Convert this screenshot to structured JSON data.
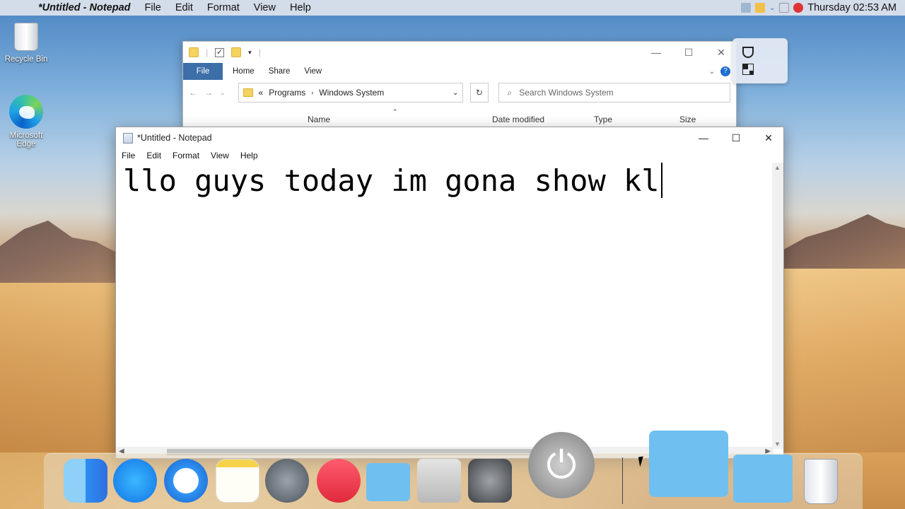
{
  "menubar": {
    "app_name": "*Untitled - Notepad",
    "items": [
      "File",
      "Edit",
      "Format",
      "View",
      "Help"
    ],
    "clock": "Thursday 02:53 AM"
  },
  "desktop": {
    "icons": [
      {
        "label": "Recycle Bin"
      },
      {
        "label": "Microsoft Edge"
      }
    ]
  },
  "explorer": {
    "ribbon_tabs": [
      "File",
      "Home",
      "Share",
      "View"
    ],
    "breadcrumb": [
      "Programs",
      "Windows System"
    ],
    "search_placeholder": "Search Windows System",
    "columns": [
      "Name",
      "Date modified",
      "Type",
      "Size"
    ]
  },
  "notepad": {
    "title": "*Untitled - Notepad",
    "menu": [
      "File",
      "Edit",
      "Format",
      "View",
      "Help"
    ],
    "content": "llo guys today im gona show kl"
  },
  "dock": {
    "items": [
      "finder-icon",
      "app-store-icon",
      "safari-icon",
      "notes-icon",
      "launchpad-icon",
      "music-icon",
      "applications-folder-icon",
      "mac-icon",
      "system-preferences-icon",
      "power-icon",
      "documents-folder-icon",
      "downloads-folder-icon",
      "trash-icon"
    ]
  }
}
